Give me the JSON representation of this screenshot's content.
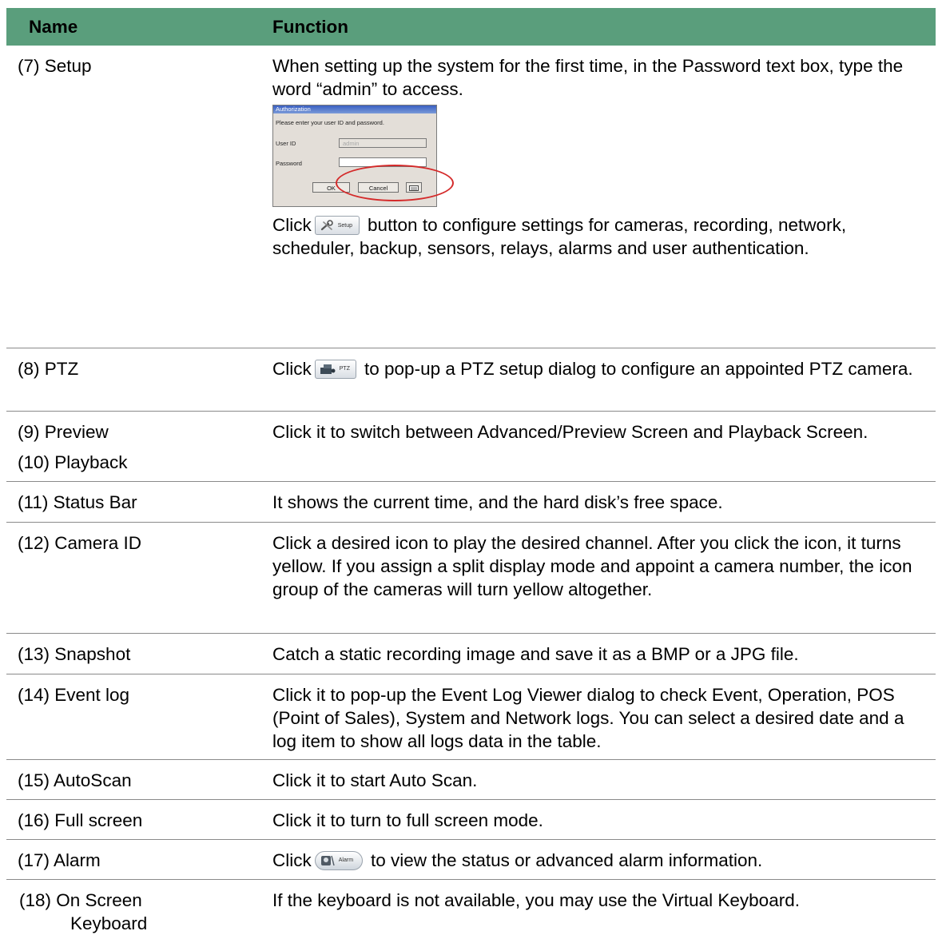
{
  "header": {
    "name": "Name",
    "function": "Function"
  },
  "rows": [
    {
      "name": "(7) Setup",
      "func1": "When setting up the system for the first time, in the Password text box, type the word “admin” to access.",
      "dialog": {
        "title": "Authorization",
        "prompt": "Please enter your user ID and password.",
        "user_label": "User ID",
        "user_value": "admin",
        "password_label": "Password",
        "password_value": "",
        "ok": "OK",
        "cancel": "Cancel",
        "keyboard_icon": "keyboard-icon"
      },
      "func2_pre": "Click",
      "button_label": "Setup",
      "func2_post": "button to configure settings for cameras, recording, network, scheduler, backup, sensors, relays, alarms and user authentication."
    },
    {
      "name": "(8) PTZ",
      "func_pre": "Click",
      "button_label": "PTZ",
      "func_post": "to pop-up a PTZ setup dialog to configure an appointed PTZ camera."
    },
    {
      "name1": "(9) Preview",
      "name2": "(10) Playback",
      "func": "Click it to switch between Advanced/Preview Screen and Playback Screen."
    },
    {
      "name": "(11) Status Bar",
      "func": "It shows the current time, and the hard disk’s free space."
    },
    {
      "name": "(12) Camera ID",
      "func": "Click a desired icon to play the desired channel. After you click the icon, it turns yellow. If you assign a split display mode and appoint a camera number, the icon group of the cameras will turn yellow altogether."
    },
    {
      "name": "(13) Snapshot",
      "func": "Catch a static recording image and save it as a BMP or a JPG file."
    },
    {
      "name": "(14) Event log",
      "func": "Click it to pop-up the Event Log Viewer dialog to check Event, Operation, POS (Point of Sales), System and Network logs. You can select a desired date and a log item to show all logs data in the table."
    },
    {
      "name": "(15) AutoScan",
      "func": "Click it to start Auto Scan."
    },
    {
      "name": "(16) Full screen",
      "func": "Click it to turn to full screen mode."
    },
    {
      "name": "(17) Alarm",
      "func_pre": "Click",
      "button_label": "Alarm",
      "func_post": "to view the status or advanced alarm information."
    },
    {
      "name1": "(18) On Screen",
      "name2": "Keyboard",
      "func": "If the keyboard is not available, you may use the Virtual Keyboard."
    }
  ],
  "colors": {
    "header_bg": "#5a9e7c",
    "row_border": "#8a8a8a",
    "highlight_ring": "#d42a2a"
  }
}
